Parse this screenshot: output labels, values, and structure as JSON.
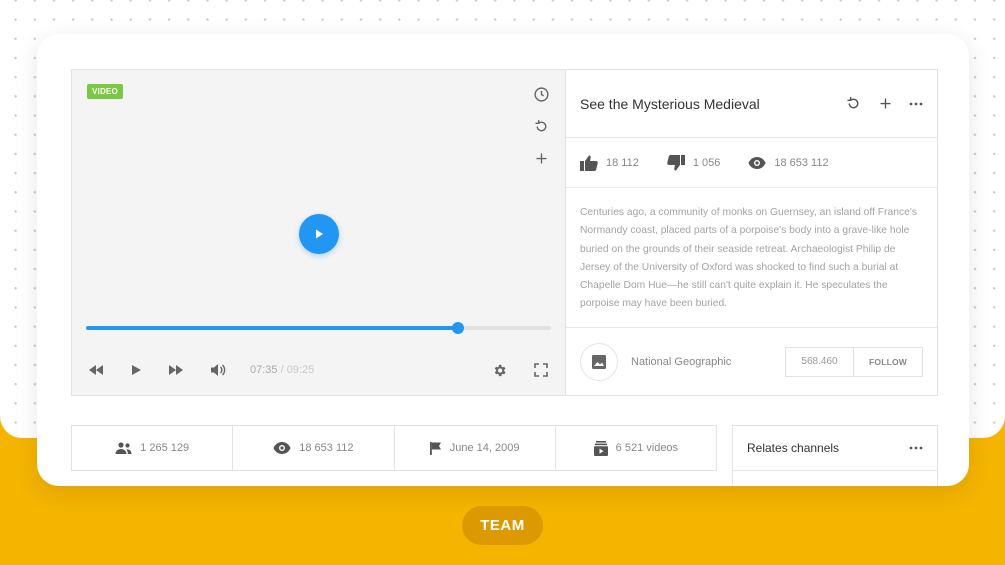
{
  "video": {
    "badge": "VIDEO",
    "current_time": "07:35",
    "total_time": "/ 09:25",
    "progress": 0.8
  },
  "info": {
    "title": "See the Mysterious Medieval",
    "likes": "18 112",
    "dislikes": "1 056",
    "views": "18 653 112",
    "description": "Centuries ago, a community of monks on Guernsey, an island off France's Normandy coast, placed parts of a porpoise's body into a grave-like hole buried on the grounds of their seaside retreat. Archaeologist Philip de Jersey of the University of Oxford was shocked to find such a burial at Chapelle Dom Hue—he still can't quite explain it. He speculates the porpoise may have been buried."
  },
  "channel": {
    "name": "National Geographic",
    "followers": "568.460",
    "follow_label": "FOLLOW"
  },
  "bottom_stats": {
    "subscribers": "1 265 129",
    "views": "18 653 112",
    "joined": "June 14, 2009",
    "videos": "6 521 videos"
  },
  "related": {
    "title": "Relates channels"
  },
  "footer": {
    "team_label": "TEAM"
  },
  "colors": {
    "accent": "#2196f3",
    "badge": "#7ac943",
    "background": "#f5b400",
    "team_button": "#dd9a00"
  },
  "icons": [
    "clock-icon",
    "replay-icon",
    "plus-icon",
    "play-icon",
    "rewind-icon",
    "fast-forward-icon",
    "volume-icon",
    "gear-icon",
    "fullscreen-icon",
    "more-icon",
    "thumb-up-icon",
    "thumb-down-icon",
    "eye-icon",
    "image-icon",
    "people-icon",
    "flag-icon",
    "video-stack-icon"
  ]
}
